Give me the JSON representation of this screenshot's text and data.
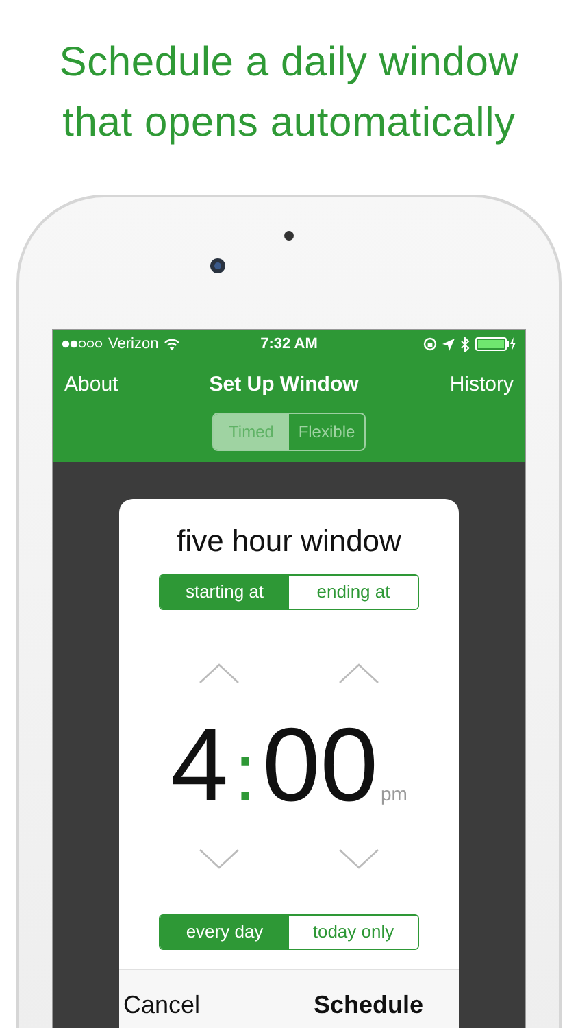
{
  "headline": "Schedule a daily window\nthat opens automatically",
  "status_bar": {
    "carrier": "Verizon",
    "time": "7:32 AM"
  },
  "nav": {
    "left": "About",
    "title": "Set Up Window",
    "right": "History"
  },
  "mode_tabs": [
    {
      "label": "Timed",
      "selected": true
    },
    {
      "label": "Flexible",
      "selected": false
    }
  ],
  "card": {
    "title": "five hour window",
    "anchor_tabs": [
      {
        "label": "starting at",
        "selected": true
      },
      {
        "label": "ending at",
        "selected": false
      }
    ],
    "time": {
      "hour": "4",
      "separator": ":",
      "minute": "00",
      "period": "pm"
    },
    "repeat_tabs": [
      {
        "label": "every day",
        "selected": true
      },
      {
        "label": "today only",
        "selected": false
      }
    ],
    "cancel": "Cancel",
    "confirm": "Schedule"
  }
}
